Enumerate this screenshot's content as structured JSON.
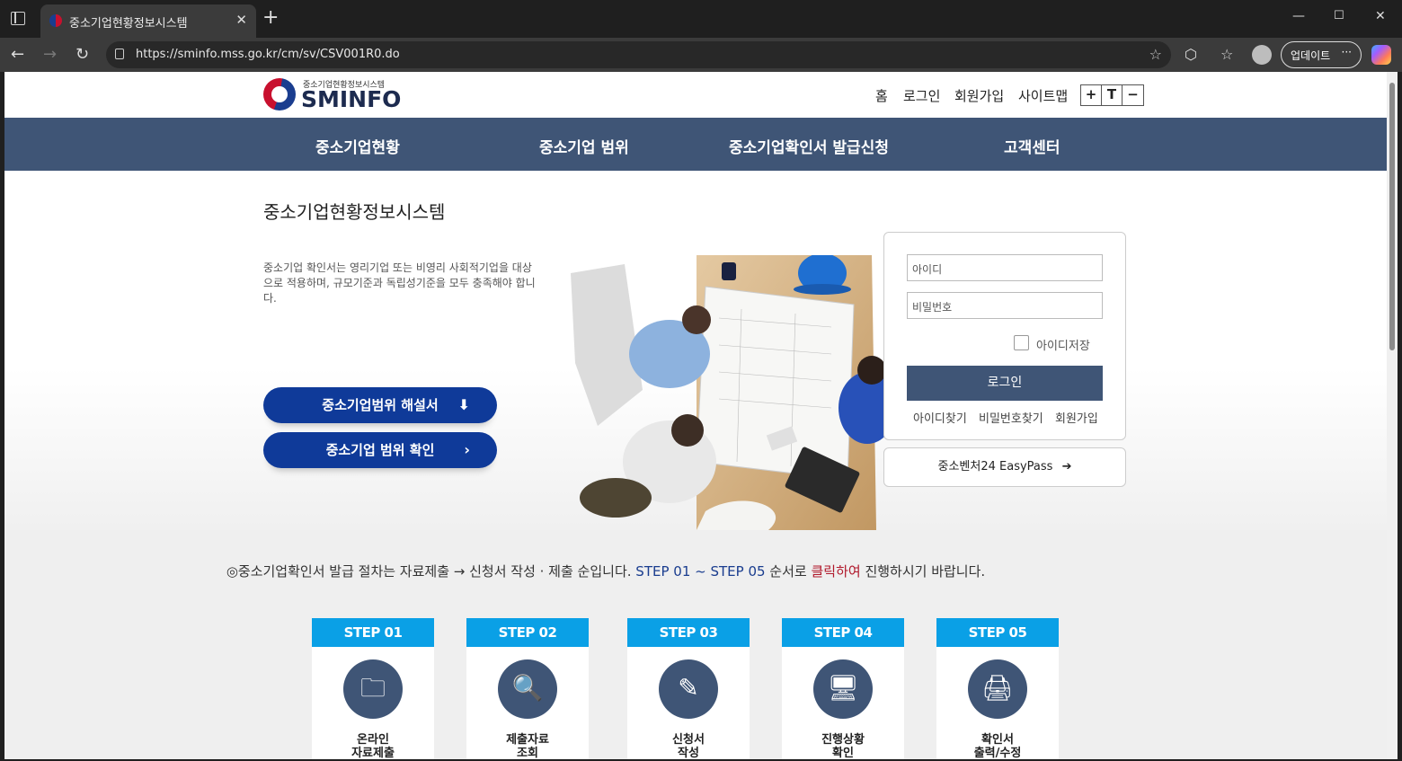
{
  "browser": {
    "tab_title": "중소기업현황정보시스템",
    "url": "https://sminfo.mss.go.kr/cm/sv/CSV001R0.do",
    "update_label": "업데이트"
  },
  "header": {
    "logo_sub": "중소기업현황정보시스템",
    "logo_main": "SMINFO",
    "util_links": [
      "홈",
      "로그인",
      "회원가입",
      "사이트맵"
    ],
    "font_controls": [
      "+",
      "T",
      "−"
    ]
  },
  "gnb": {
    "items": [
      "중소기업현황",
      "중소기업 범위",
      "중소기업확인서 발급신청",
      "고객센터"
    ]
  },
  "hero": {
    "title": "중소기업현황정보시스템",
    "description": "중소기업 확인서는 영리기업 또는 비영리 사회적기업을 대상으로 적용하며, 규모기준과 독립성기준을 모두 충족해야 합니다.",
    "btn_guide": "중소기업범위 해설서",
    "btn_check": "중소기업 범위 확인"
  },
  "login": {
    "id_placeholder": "아이디",
    "pw_placeholder": "비밀번호",
    "save_id": "아이디저장",
    "login_button": "로그인",
    "links": [
      "아이디찾기",
      "비밀번호찾기",
      "회원가입"
    ],
    "easypass": "중소벤처24 EasyPass"
  },
  "steps": {
    "notice_prefix": "◎중소기업확인서 발급 절차는 자료제출 → 신청서 작성 · 제출 순입니다. ",
    "notice_blue": "STEP 01 ~ STEP 05",
    "notice_mid": " 순서로 ",
    "notice_red": "클릭하여",
    "notice_suffix": " 진행하시기 바랍니다.",
    "items": [
      {
        "label": "STEP 01",
        "name": "온라인\n자료제출",
        "icon": "folder-icon"
      },
      {
        "label": "STEP 02",
        "name": "제출자료\n조회",
        "icon": "search-document-icon"
      },
      {
        "label": "STEP 03",
        "name": "신청서\n작성",
        "icon": "form-edit-icon"
      },
      {
        "label": "STEP 04",
        "name": "진행상황\n확인",
        "icon": "monitor-person-icon"
      },
      {
        "label": "STEP 05",
        "name": "확인서\n출력/수정",
        "icon": "print-edit-icon"
      }
    ]
  }
}
